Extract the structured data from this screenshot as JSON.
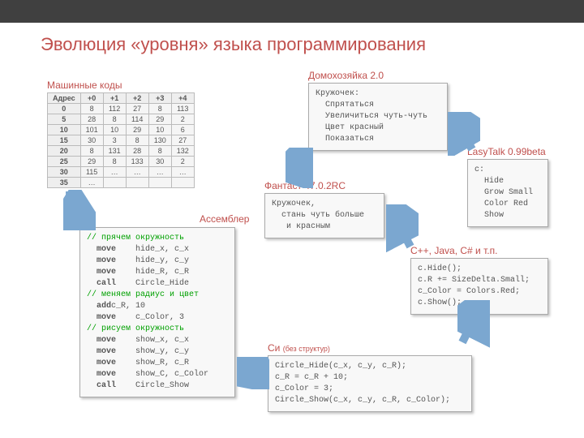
{
  "title": "Эволюция «уровня» языка программирования",
  "labels": {
    "machine": "Машинные коды",
    "asm": "Ассемблер",
    "housewife": "Домохозяйка 2.0",
    "lasy": "LasyTalk 0.99beta",
    "fantast": "Фантаст 47.0.2RC",
    "cpp": "C++, Java, C# и т.п.",
    "c_prefix": "Си ",
    "c_suffix": "(без структур)"
  },
  "table": {
    "headers": [
      "Адрес",
      "+0",
      "+1",
      "+2",
      "+3",
      "+4"
    ],
    "rows": [
      [
        "0",
        "8",
        "112",
        "27",
        "8",
        "113"
      ],
      [
        "5",
        "28",
        "8",
        "114",
        "29",
        "2"
      ],
      [
        "10",
        "101",
        "10",
        "29",
        "10",
        "6"
      ],
      [
        "15",
        "30",
        "3",
        "8",
        "130",
        "27"
      ],
      [
        "20",
        "8",
        "131",
        "28",
        "8",
        "132"
      ],
      [
        "25",
        "29",
        "8",
        "133",
        "30",
        "2"
      ],
      [
        "30",
        "115",
        "…",
        "…",
        "…",
        "…"
      ],
      [
        "35",
        "…",
        "",
        "",
        "",
        ""
      ]
    ]
  },
  "asm": {
    "c1": "// прячем окружность",
    "l1a": "  move",
    "l1b": "    hide_x, c_x",
    "l2a": "  move",
    "l2b": "    hide_y, c_y",
    "l3a": "  move",
    "l3b": "    hide_R, c_R",
    "l4a": "  call",
    "l4b": "    Circle_Hide",
    "c2": "// меняем радиус и цвет",
    "l5a": "  add",
    "l5b": "c_R, 10",
    "l6a": "  move",
    "l6b": "    c_Color, 3",
    "c3": "// рисуем окружность",
    "l7a": "  move",
    "l7b": "    show_x, c_x",
    "l8a": "  move",
    "l8b": "    show_y, c_y",
    "l9a": "  move",
    "l9b": "    show_R, c_R",
    "l10a": "  move",
    "l10b": "    show_C, c_Color",
    "l11a": "  call",
    "l11b": "    Circle_Show"
  },
  "housewife": "Кружочек:\n  Спрятаться\n  Увеличиться чуть-чуть\n  Цвет красный\n  Показаться",
  "lasy": "c:\n  Hide\n  Grow Small\n  Color Red\n  Show",
  "fantast": "Кружочек,\n  стань чуть больше\n   и красным",
  "cpp": "c.Hide();\nc.R += SizeDelta.Small;\nc_Color = Colors.Red;\nc.Show();",
  "c_code": "Circle_Hide(c_x, c_y, c_R);\nc_R = c_R + 10;\nc_Color = 3;\nCircle_Show(c_x, c_y, c_R, c_Color);"
}
